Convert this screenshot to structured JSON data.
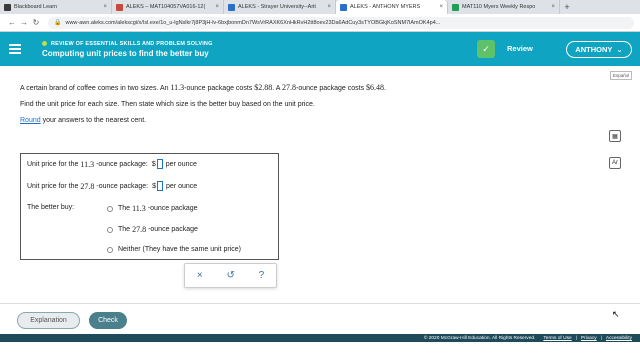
{
  "browser": {
    "tabs": [
      {
        "title": "Blackboard Learn",
        "favicon_color": "#3a3a3a",
        "active": false
      },
      {
        "title": "ALEKS – MAT104057VA016-12(",
        "favicon_color": "#c94a3a",
        "active": false
      },
      {
        "title": "ALEKS - Strayer University--Arit",
        "favicon_color": "#2a6fc9",
        "active": false
      },
      {
        "title": "ALEKS - ANTHONY MYERS",
        "favicon_color": "#2a6fc9",
        "active": true
      },
      {
        "title": "MAT110 Myers Weekly Respo",
        "favicon_color": "#1e9e57",
        "active": false
      }
    ],
    "new_tab_label": "+",
    "url": "www-awn.aleks.com/alekscgi/x/Isl.exe/1o_u-lgNslkr7j8P3jH-lv-6bxjbonmDn7WsVrRAXK6XnHkRvH2tt8oev23Da6AdCuy3sTYOBGkjKoSNM7lAmOK4p4..."
  },
  "header": {
    "subtitle": "REVIEW OF ESSENTIAL SKILLS AND PROBLEM SOLVING",
    "title": "Computing unit prices to find the better buy",
    "review_label": "Review",
    "user_name": "ANTHONY",
    "accent_color": "#0ea4c2"
  },
  "espanol_label": "Español",
  "problem": {
    "line1_a": "A certain brand of coffee comes in two sizes. An",
    "size1": "11.3",
    "line1_b": "-ounce package costs",
    "price1": "$2.88",
    "line1_c": ". A",
    "size2": "27.8",
    "line1_d": "-ounce package costs",
    "price2": "$6.48",
    "line1_e": ".",
    "line2": "Find the unit price for each size. Then state which size is the better buy based on the unit price.",
    "round_link": "Round",
    "line3_rest": "your answers to the nearest cent."
  },
  "answer_panel": {
    "row1_label_a": "Unit price for the",
    "row1_size": "11.3",
    "row1_label_b": "-ounce package:",
    "row2_label_a": "Unit price for the",
    "row2_size": "27.8",
    "row2_label_b": "-ounce package:",
    "currency": "$",
    "unit_suffix": "per ounce",
    "better_buy_label": "The better buy:",
    "options": [
      {
        "prefix": "The",
        "size": "11.3",
        "suffix": "-ounce package"
      },
      {
        "prefix": "The",
        "size": "27.8",
        "suffix": "-ounce package"
      },
      {
        "text": "Neither (They have the same unit price)"
      }
    ]
  },
  "actions": {
    "clear": "×",
    "undo": "↺",
    "help": "?"
  },
  "side_tools": {
    "calculator": "▦",
    "periodic": "Ar"
  },
  "footer": {
    "explanation_label": "Explanation",
    "check_label": "Check",
    "copyright": "© 2020 McGraw-Hill Education. All Rights Reserved.",
    "terms": "Terms of Use",
    "privacy": "Privacy",
    "accessibility": "Accessibility"
  }
}
